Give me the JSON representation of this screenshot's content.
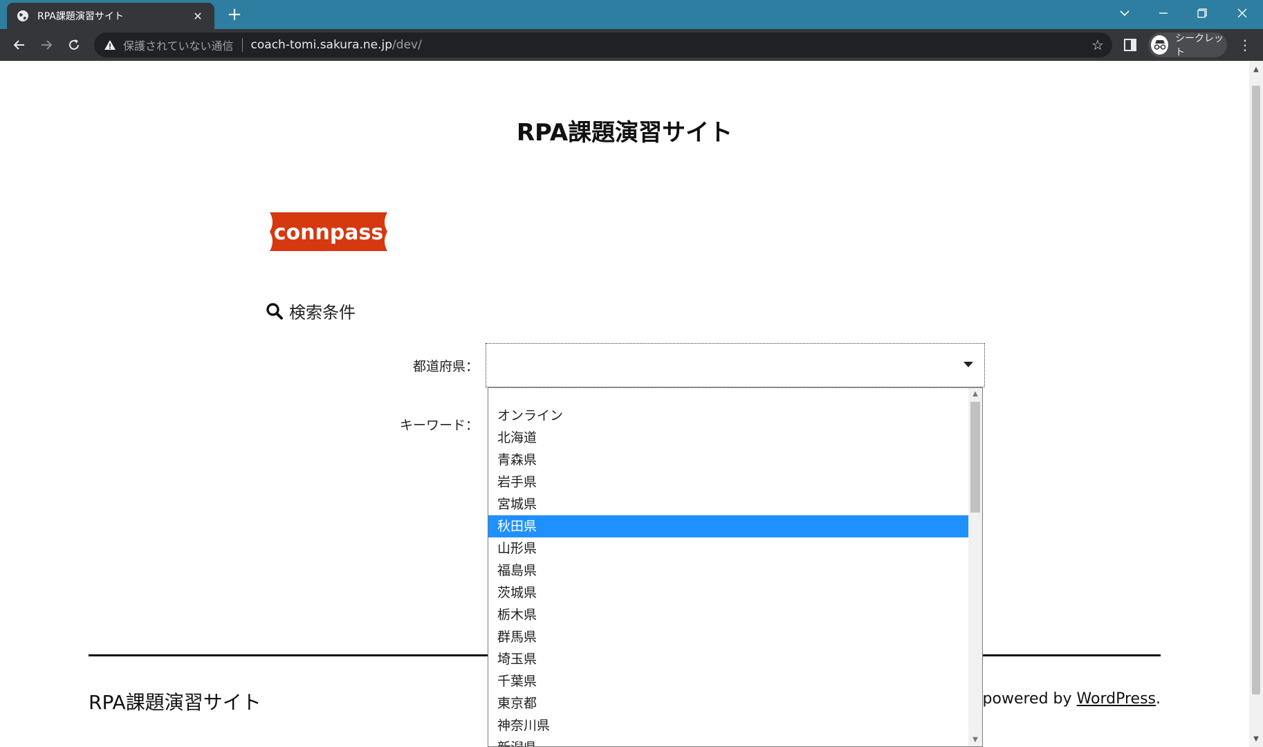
{
  "browser": {
    "tab_title": "RPA課題演習サイト",
    "new_tab_symbol": "+",
    "close_symbol": "✕",
    "security_text": "保護されていない通信",
    "url_host": "coach-tomi.sakura.ne.jp",
    "url_path": "/dev/",
    "incognito_label": "シークレット",
    "icons": [
      "globe-icon",
      "close-icon",
      "add-icon",
      "back-icon",
      "forward-icon",
      "reload-icon",
      "warning-icon",
      "star-icon",
      "side-panel-icon",
      "incognito-icon",
      "menu-icon"
    ]
  },
  "page": {
    "site_title": "RPA課題演習サイト",
    "logo_text": "connpass",
    "search_heading": "検索条件",
    "prefecture_label": "都道府県：",
    "keyword_label": "キーワード：",
    "prefecture_value": ""
  },
  "dropdown": {
    "options": [
      "",
      "オンライン",
      "北海道",
      "青森県",
      "岩手県",
      "宮城県",
      "秋田県",
      "山形県",
      "福島県",
      "茨城県",
      "栃木県",
      "群馬県",
      "埼玉県",
      "千葉県",
      "東京都",
      "神奈川県",
      "新潟県"
    ],
    "selected": "秋田県"
  },
  "footer": {
    "site_name": "RPA課題演習サイト",
    "powered_prefix": "ly powered by ",
    "powered_link": "WordPress",
    "powered_suffix": "."
  },
  "colors": {
    "tabbar": "#2d7ea0",
    "toolbar": "#35363a",
    "selection": "#1e90ff",
    "logo_red": "#d6380f"
  }
}
